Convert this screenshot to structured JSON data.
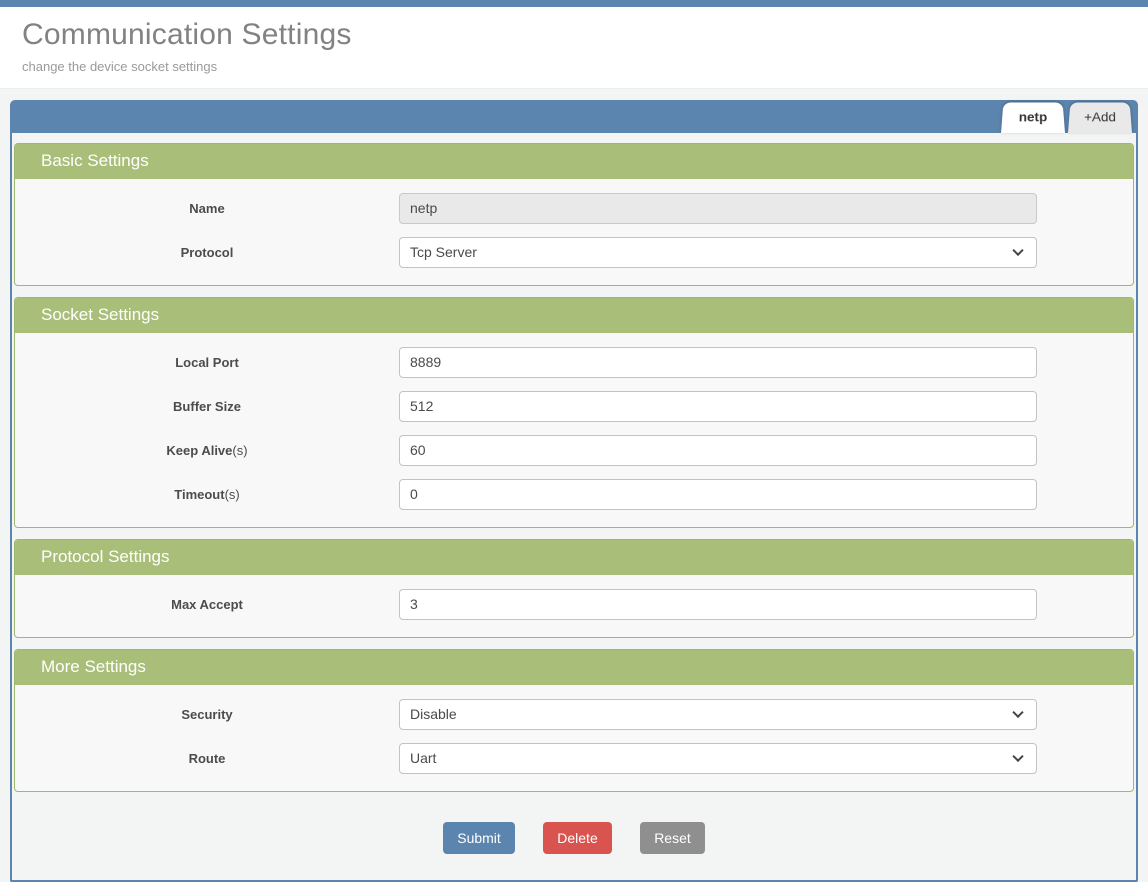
{
  "header": {
    "title": "Communication Settings",
    "subtitle": "change the device socket settings"
  },
  "tabs": {
    "active": {
      "label": "netp"
    },
    "add": {
      "label": "+Add"
    }
  },
  "sections": [
    {
      "title": "Basic Settings",
      "rows": [
        {
          "label": "Name",
          "suffix": "",
          "control": "input-disabled",
          "value": "netp"
        },
        {
          "label": "Protocol",
          "suffix": "",
          "control": "select",
          "value": "Tcp Server"
        }
      ]
    },
    {
      "title": "Socket Settings",
      "rows": [
        {
          "label": "Local Port",
          "suffix": "",
          "control": "input",
          "value": "8889"
        },
        {
          "label": "Buffer Size",
          "suffix": "",
          "control": "input",
          "value": "512"
        },
        {
          "label": "Keep Alive",
          "suffix": "(s)",
          "control": "input",
          "value": "60"
        },
        {
          "label": "Timeout",
          "suffix": "(s)",
          "control": "input",
          "value": "0"
        }
      ]
    },
    {
      "title": "Protocol Settings",
      "rows": [
        {
          "label": "Max Accept",
          "suffix": "",
          "control": "input",
          "value": "3"
        }
      ]
    },
    {
      "title": "More Settings",
      "rows": [
        {
          "label": "Security",
          "suffix": "",
          "control": "select",
          "value": "Disable"
        },
        {
          "label": "Route",
          "suffix": "",
          "control": "select",
          "value": "Uart"
        }
      ]
    }
  ],
  "buttons": {
    "submit": "Submit",
    "delete": "Delete",
    "reset": "Reset"
  },
  "colors": {
    "accent_blue": "#5b84ae",
    "section_green": "#a9bf79",
    "submit_blue": "#5b84ae",
    "delete_red": "#d9534f",
    "reset_gray": "#8f8f8f"
  }
}
